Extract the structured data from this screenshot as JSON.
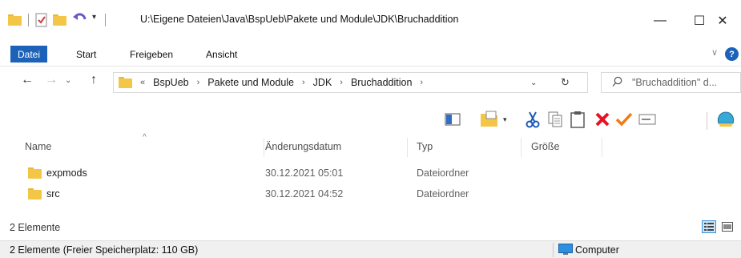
{
  "window": {
    "title": "U:\\Eigene Dateien\\Java\\BspUeb\\Pakete und Module\\JDK\\Bruchaddition",
    "minimize": "—",
    "maximize": "☐",
    "close": "✕"
  },
  "ribbon": {
    "tabs": [
      "Datei",
      "Start",
      "Freigeben",
      "Ansicht"
    ],
    "help": "?"
  },
  "address": {
    "overflow": "«",
    "crumbs": [
      "BspUeb",
      "Pakete und Module",
      "JDK",
      "Bruchaddition"
    ]
  },
  "search": {
    "placeholder": "\"Bruchaddition\" d..."
  },
  "columns": {
    "name": "Name",
    "date": "Änderungsdatum",
    "type": "Typ",
    "size": "Größe"
  },
  "files": [
    {
      "name": "expmods",
      "date": "30.12.2021 05:01",
      "type": "Dateiordner",
      "size": ""
    },
    {
      "name": "src",
      "date": "30.12.2021 04:52",
      "type": "Dateiordner",
      "size": ""
    }
  ],
  "footer": {
    "item_count": "2 Elemente",
    "status": "2 Elemente (Freier Speicherplatz: 110 GB)",
    "location": "Computer"
  },
  "colors": {
    "accent": "#1c62b8",
    "folder": "#f4c647",
    "delete": "#e81123",
    "check": "#f07b14"
  }
}
